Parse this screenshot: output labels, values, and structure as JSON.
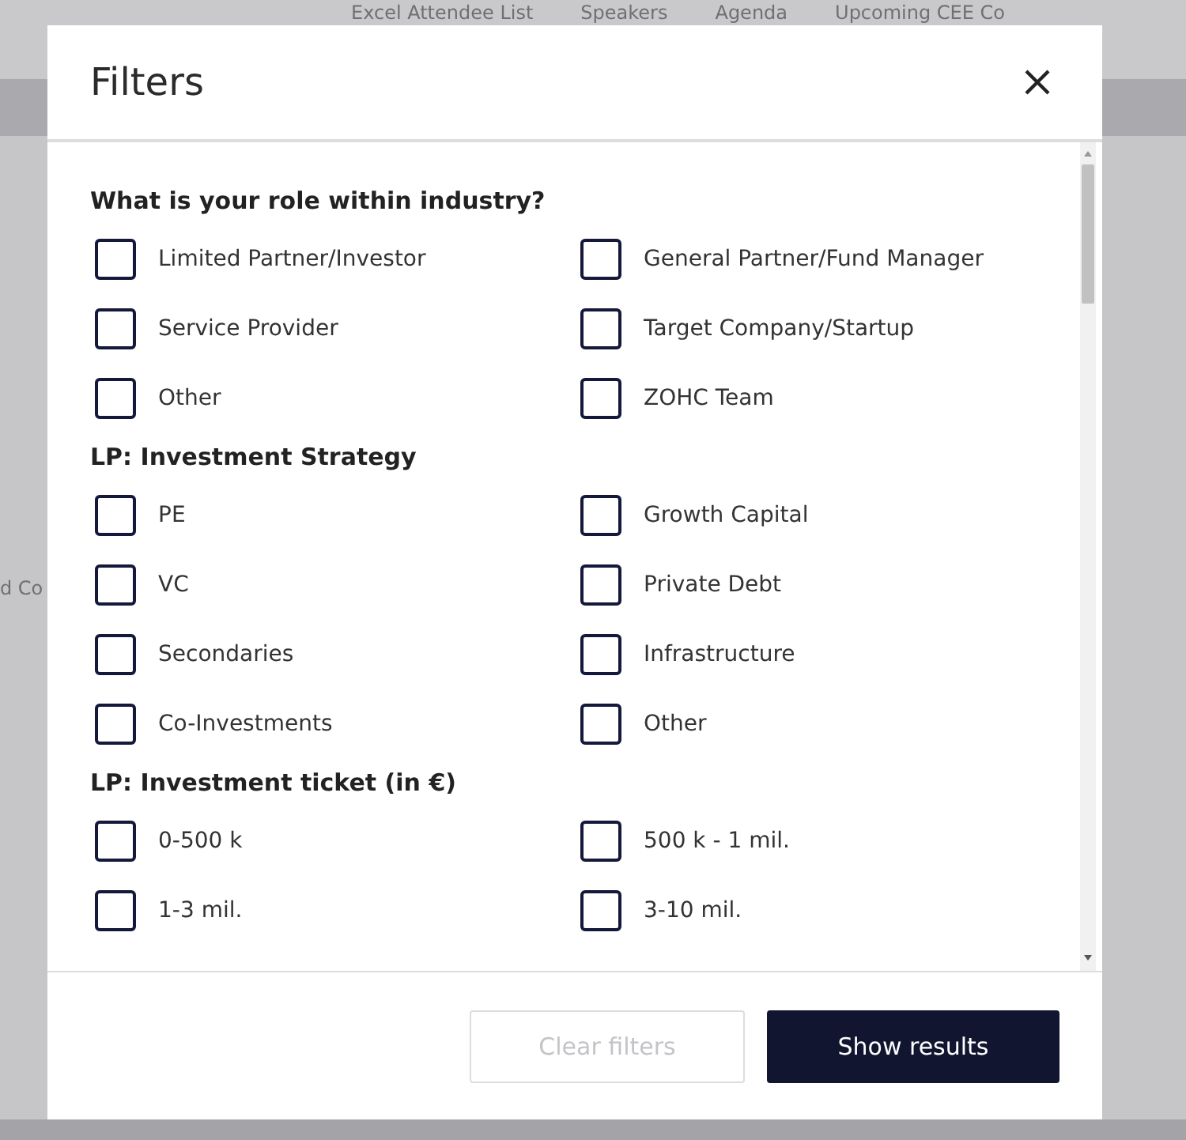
{
  "background": {
    "nav": [
      "Excel Attendee List",
      "Speakers",
      "Agenda",
      "Upcoming CEE Co"
    ],
    "fragment": "d Co"
  },
  "modal": {
    "title": "Filters",
    "sections": [
      {
        "title": "What is your role within industry?",
        "options": [
          {
            "label": "Limited Partner/Investor",
            "checked": false
          },
          {
            "label": "General Partner/Fund Manager",
            "checked": false
          },
          {
            "label": "Service Provider",
            "checked": false
          },
          {
            "label": "Target Company/Startup",
            "checked": false
          },
          {
            "label": "Other",
            "checked": false
          },
          {
            "label": "ZOHC Team",
            "checked": false
          }
        ]
      },
      {
        "title": "LP: Investment Strategy",
        "options": [
          {
            "label": "PE",
            "checked": false
          },
          {
            "label": "Growth Capital",
            "checked": false
          },
          {
            "label": "VC",
            "checked": false
          },
          {
            "label": "Private Debt",
            "checked": false
          },
          {
            "label": "Secondaries",
            "checked": false
          },
          {
            "label": "Infrastructure",
            "checked": false
          },
          {
            "label": "Co-Investments",
            "checked": false
          },
          {
            "label": "Other",
            "checked": false
          }
        ]
      },
      {
        "title": "LP: Investment ticket (in €)",
        "options": [
          {
            "label": "0-500 k",
            "checked": false
          },
          {
            "label": "500 k - 1 mil.",
            "checked": false
          },
          {
            "label": "1-3 mil.",
            "checked": false
          },
          {
            "label": "3-10 mil.",
            "checked": false
          }
        ]
      }
    ],
    "buttons": [
      {
        "label": "Clear filters",
        "disabled": true
      },
      {
        "label": "Show results",
        "disabled": false
      }
    ]
  }
}
